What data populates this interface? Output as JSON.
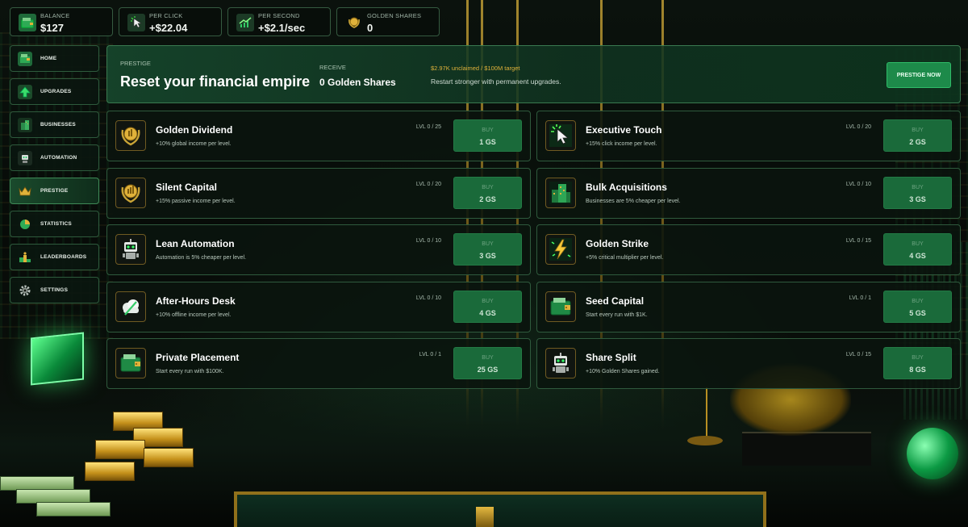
{
  "stats": [
    {
      "label": "BALANCE",
      "value": "$127",
      "icon": "wallet-icon"
    },
    {
      "label": "PER CLICK",
      "value": "+$22.04",
      "icon": "cursor-click-icon"
    },
    {
      "label": "PER SECOND",
      "value": "+$2.1/sec",
      "icon": "trend-chart-icon"
    },
    {
      "label": "GOLDEN SHARES",
      "value": "0",
      "icon": "golden-laurel-icon"
    }
  ],
  "sidebar": {
    "items": [
      {
        "label": "HOME",
        "icon": "wallet-icon",
        "active": false
      },
      {
        "label": "UPGRADES",
        "icon": "up-arrow-icon",
        "active": false
      },
      {
        "label": "BUSINESSES",
        "icon": "building-icon",
        "active": false
      },
      {
        "label": "AUTOMATION",
        "icon": "robot-icon",
        "active": false
      },
      {
        "label": "PRESTIGE",
        "icon": "crown-icon",
        "active": true
      },
      {
        "label": "STATISTICS",
        "icon": "pie-chart-icon",
        "active": false
      },
      {
        "label": "LEADERBOARDS",
        "icon": "trophy-podium-icon",
        "active": false
      },
      {
        "label": "SETTINGS",
        "icon": "gear-icon",
        "active": false
      }
    ]
  },
  "prestige": {
    "kicker": "PRESTIGE",
    "title": "Reset your financial empire",
    "receive_label": "RECEIVE",
    "receive_value": "0 Golden Shares",
    "unclaimed": "$2.97K unclaimed / $100M target",
    "description": "Restart stronger with permanent upgrades.",
    "button": "PRESTIGE NOW"
  },
  "upgrades": [
    {
      "name": "Golden Dividend",
      "desc": "+10% global income per level.",
      "level": "LVL 0 / 25",
      "buy": "BUY",
      "cost": "1 GS",
      "icon": "golden-laurel-icon"
    },
    {
      "name": "Executive Touch",
      "desc": "+15% click income per level.",
      "level": "LVL 0 / 20",
      "buy": "BUY",
      "cost": "2 GS",
      "icon": "cursor-click-icon"
    },
    {
      "name": "Silent Capital",
      "desc": "+15% passive income per level.",
      "level": "LVL 0 / 20",
      "buy": "BUY",
      "cost": "2 GS",
      "icon": "golden-laurel-icon"
    },
    {
      "name": "Bulk Acquisitions",
      "desc": "Businesses are 5% cheaper per level.",
      "level": "LVL 0 / 10",
      "buy": "BUY",
      "cost": "3 GS",
      "icon": "building-icon"
    },
    {
      "name": "Lean Automation",
      "desc": "Automation is 5% cheaper per level.",
      "level": "LVL 0 / 10",
      "buy": "BUY",
      "cost": "3 GS",
      "icon": "robot-icon"
    },
    {
      "name": "Golden Strike",
      "desc": "+5% critical multiplier per level.",
      "level": "LVL 0 / 15",
      "buy": "BUY",
      "cost": "4 GS",
      "icon": "lightning-icon"
    },
    {
      "name": "After-Hours Desk",
      "desc": "+10% offline income per level.",
      "level": "LVL 0 / 10",
      "buy": "BUY",
      "cost": "4 GS",
      "icon": "cloud-icon"
    },
    {
      "name": "Seed Capital",
      "desc": "Start every run with $1K.",
      "level": "LVL 0 / 1",
      "buy": "BUY",
      "cost": "5 GS",
      "icon": "wallet-icon"
    },
    {
      "name": "Private Placement",
      "desc": "Start every run with $100K.",
      "level": "LVL 0 / 1",
      "buy": "BUY",
      "cost": "25 GS",
      "icon": "wallet-icon"
    },
    {
      "name": "Share Split",
      "desc": "+10% Golden Shares gained.",
      "level": "LVL 0 / 15",
      "buy": "BUY",
      "cost": "8 GS",
      "icon": "robot-icon"
    }
  ],
  "colors": {
    "accent_green": "#1d8a4a",
    "gold": "#e0b23a",
    "panel_border": "#2f5a3d"
  }
}
